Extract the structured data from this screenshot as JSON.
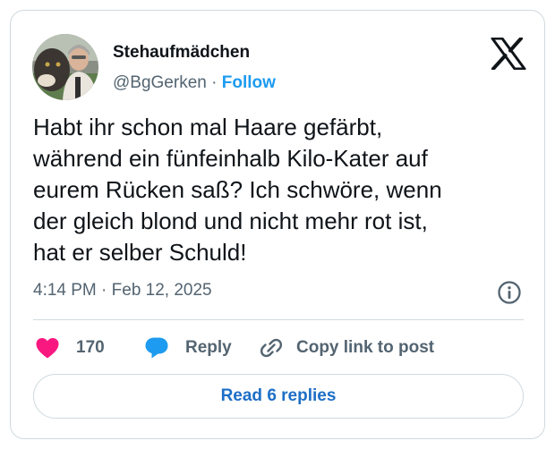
{
  "author": {
    "name": "Stehaufmädchen",
    "handle": "@BgGerken",
    "separator": "·",
    "follow_label": "Follow"
  },
  "post": {
    "text": "Habt ihr schon mal Haare gefärbt,\nwährend ein fünfeinhalb Kilo-Kater auf\neurem Rücken saß? Ich schwöre, wenn\nder gleich blond und nicht mehr rot ist,\nhat er selber Schuld!",
    "timestamp": "4:14 PM · Feb 12, 2025"
  },
  "actions": {
    "like_count": "170",
    "reply_label": "Reply",
    "copy_label": "Copy link to post"
  },
  "footer": {
    "read_replies_label": "Read 6 replies"
  },
  "icons": {
    "logo": "x-logo-icon",
    "info": "info-icon",
    "like": "heart-icon",
    "reply": "speech-bubble-icon",
    "copy": "link-icon"
  },
  "colors": {
    "accent": "#1d9bf0",
    "heart": "#f91880",
    "reply_bubble": "#1d9bf0",
    "text_primary": "#0f1419",
    "text_secondary": "#536471",
    "border": "#cfd9de"
  }
}
